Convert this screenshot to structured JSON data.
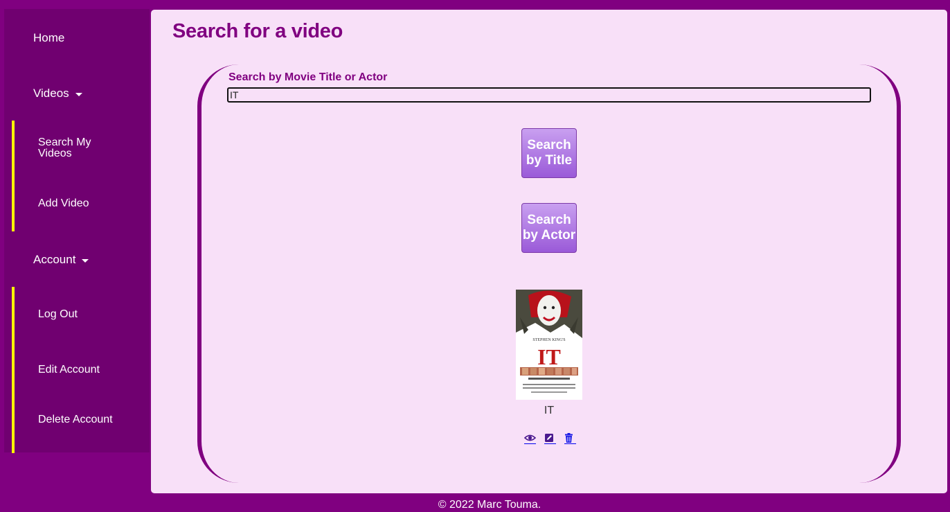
{
  "sidebar": {
    "home": "Home",
    "videos": "Videos",
    "videos_items": [
      "Search My Videos",
      "Add Video"
    ],
    "account": "Account",
    "account_items": [
      "Log Out",
      "Edit Account",
      "Delete Account"
    ]
  },
  "main": {
    "title": "Search for a video",
    "search_label": "Search by Movie Title or Actor",
    "search_value": "IT",
    "btn_title": "Search by Title",
    "btn_actor": "Search by Actor",
    "results": [
      {
        "title": "IT",
        "poster_text": "IT",
        "actions": [
          "view-icon",
          "edit-icon",
          "delete-icon"
        ]
      }
    ]
  },
  "footer": "© 2022 Marc Touma.",
  "colors": {
    "brand": "#800080",
    "sidebar": "#700070",
    "background": "#f8e0f8",
    "accent": "#ffff00",
    "button": "#b07ae6"
  }
}
